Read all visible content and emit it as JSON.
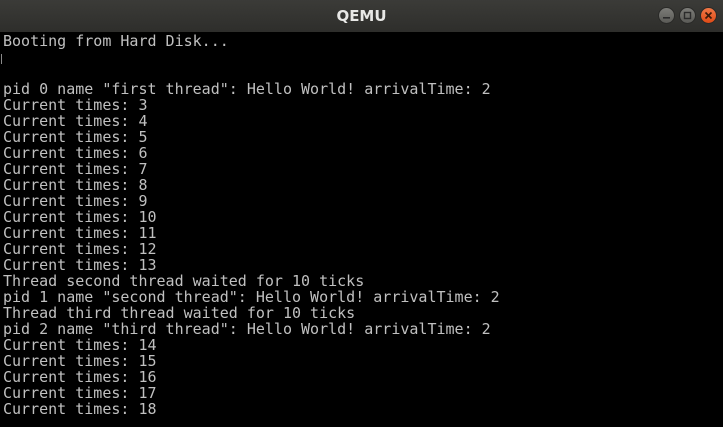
{
  "window": {
    "title": "QEMU",
    "controls": {
      "minimize": "minimize-icon",
      "maximize": "maximize-icon",
      "close": "close-icon"
    }
  },
  "console": {
    "lines": [
      "Booting from Hard Disk...",
      "",
      "",
      "pid 0 name \"first thread\": Hello World! arrivalTime: 2",
      "Current times: 3",
      "Current times: 4",
      "Current times: 5",
      "Current times: 6",
      "Current times: 7",
      "Current times: 8",
      "Current times: 9",
      "Current times: 10",
      "Current times: 11",
      "Current times: 12",
      "Current times: 13",
      "Thread second thread waited for 10 ticks",
      "pid 1 name \"second thread\": Hello World! arrivalTime: 2",
      "Thread third thread waited for 10 ticks",
      "pid 2 name \"third thread\": Hello World! arrivalTime: 2",
      "Current times: 14",
      "Current times: 15",
      "Current times: 16",
      "Current times: 17",
      "Current times: 18"
    ]
  },
  "colors": {
    "background": "#000000",
    "text": "#c0c0c0",
    "titlebar": "#353532",
    "title_text": "#e8e8e6",
    "close_button": "#e95420"
  }
}
